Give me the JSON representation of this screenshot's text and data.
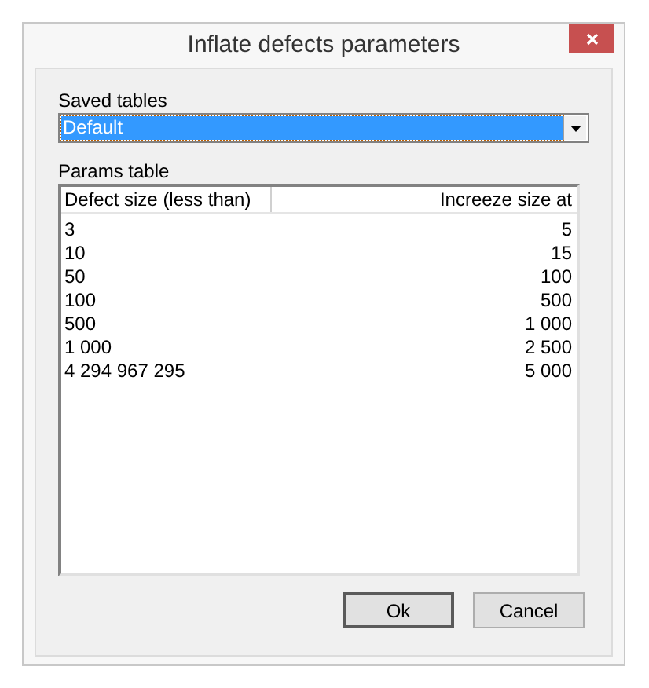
{
  "window": {
    "title": "Inflate defects parameters"
  },
  "saved_tables": {
    "label": "Saved tables",
    "value": "Default",
    "selected": true
  },
  "params_table": {
    "label": "Params table",
    "columns": [
      "Defect size (less than)",
      "Increeze size at"
    ],
    "rows": [
      [
        "3",
        "5"
      ],
      [
        "10",
        "15"
      ],
      [
        "50",
        "100"
      ],
      [
        "100",
        "500"
      ],
      [
        "500",
        "1 000"
      ],
      [
        "1 000",
        "2 500"
      ],
      [
        "4 294 967 295",
        "5 000"
      ]
    ]
  },
  "buttons": [
    {
      "label": "Ok",
      "default": true
    },
    {
      "label": "Cancel",
      "default": false
    }
  ]
}
